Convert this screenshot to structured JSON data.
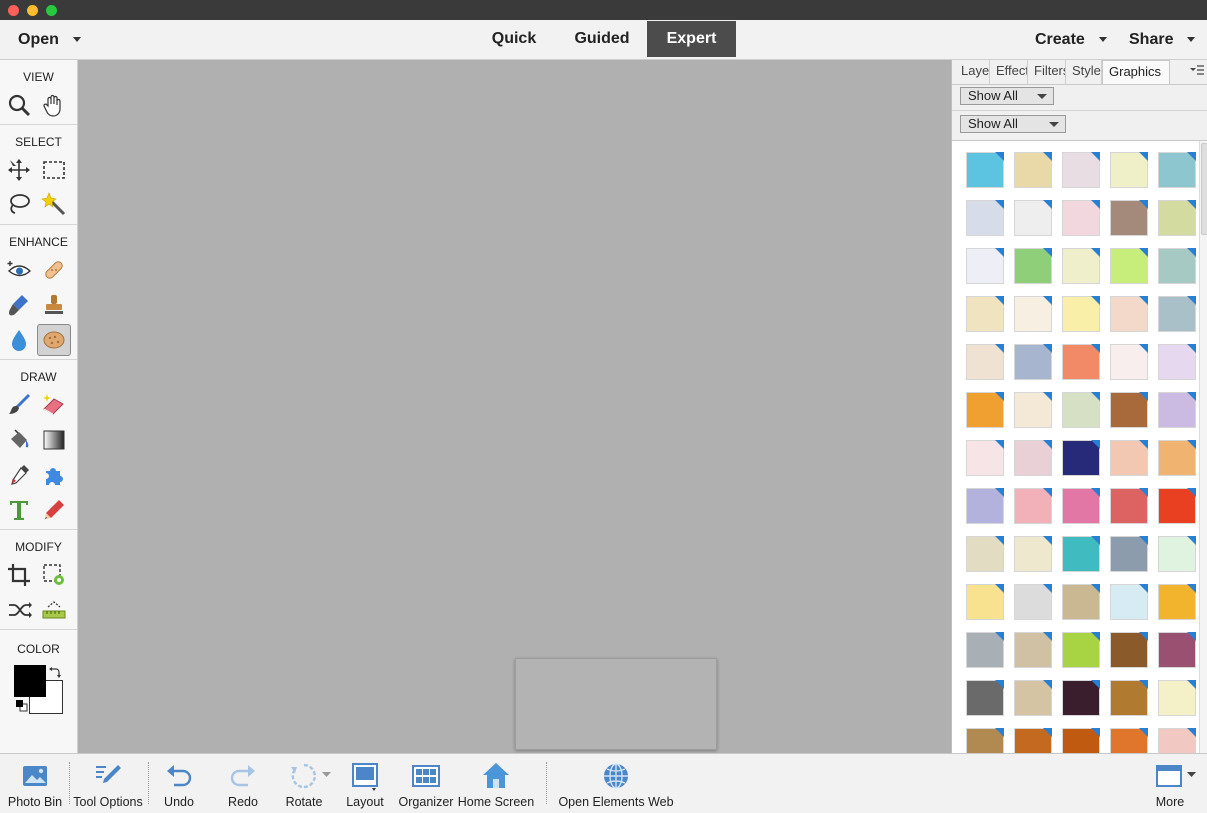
{
  "topbar": {
    "open_label": "Open",
    "modes": [
      "Quick",
      "Guided",
      "Expert"
    ],
    "active_mode": "Expert",
    "create_label": "Create",
    "share_label": "Share"
  },
  "toolbox": {
    "sections": {
      "view": "VIEW",
      "select": "SELECT",
      "enhance": "ENHANCE",
      "draw": "DRAW",
      "modify": "MODIFY",
      "color": "COLOR"
    }
  },
  "panel": {
    "tabs": [
      "Layers",
      "Effects",
      "Filters",
      "Styles",
      "Graphics"
    ],
    "active_tab": "Graphics",
    "dropdown1": "Show All",
    "dropdown2": "Show All",
    "thumbnail_colors": [
      [
        "#5cc3e0",
        "#e9d9a8",
        "#e7dde3",
        "#f0f0c8",
        "#8dc6cf"
      ],
      [
        "#d6dde8",
        "#eeeeee",
        "#f2d8de",
        "#a48a7a",
        "#d3dba0"
      ],
      [
        "#eeeef6",
        "#8fcf7a",
        "#efefcc",
        "#c7ee7a",
        "#a7c9c4"
      ],
      [
        "#f0e4c0",
        "#f6efe2",
        "#f9efa8",
        "#f2d9c9",
        "#a9c0c9"
      ],
      [
        "#f0e2d2",
        "#a7b5cf",
        "#f28a68",
        "#f8eeee",
        "#e6d8ef"
      ],
      [
        "#f0a030",
        "#f3e9d6",
        "#d6e0c4",
        "#a86a3a",
        "#cbbbe2"
      ],
      [
        "#f6e4e6",
        "#e9d0d6",
        "#262a78",
        "#f2c8b2",
        "#f0b470"
      ],
      [
        "#b2b2dc",
        "#f2b0b8",
        "#e277a6",
        "#dd6262",
        "#e84020"
      ],
      [
        "#e2dcc2",
        "#eee8cf",
        "#40bcc0",
        "#8c9cac",
        "#e0f2e0"
      ],
      [
        "#f8e290",
        "#dcdcdc",
        "#c9b892",
        "#d6ecf2",
        "#f2b42c"
      ],
      [
        "#a8b0b6",
        "#d0c0a4",
        "#a8d444",
        "#8a5a2a",
        "#9a5070"
      ],
      [
        "#6a6a6a",
        "#d4c4a4",
        "#3a1e2e",
        "#b07a30",
        "#f4f0c8"
      ],
      [
        "#b08a50",
        "#c46a20",
        "#c05a10",
        "#e0762c",
        "#f2c8c2"
      ]
    ]
  },
  "bottombar": {
    "photo_bin": "Photo Bin",
    "tool_options": "Tool Options",
    "undo": "Undo",
    "redo": "Redo",
    "rotate": "Rotate",
    "layout": "Layout",
    "organizer": "Organizer",
    "home_screen": "Home Screen",
    "open_elements_web": "Open Elements Web",
    "more": "More"
  },
  "colors": {
    "canvas_bg": "#b0b0b0",
    "active_mode_bg": "#4c4c4c",
    "foreground_color": "#000000",
    "background_color": "#ffffff",
    "thumbnail_badge": "#2a7fd1"
  }
}
